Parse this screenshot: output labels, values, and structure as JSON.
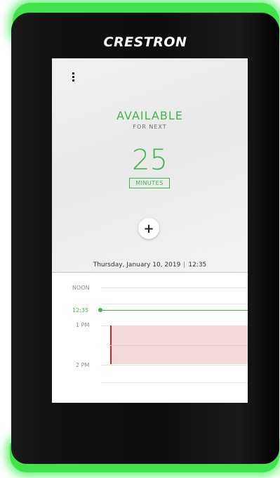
{
  "device": {
    "brand": "CRESTRON"
  },
  "room": {
    "status": "AVAILABLE",
    "status_sub": "FOR NEXT",
    "minutes": "25",
    "minutes_label": "MINUTES",
    "add_button": "+",
    "date": "Thursday, January 10, 2019",
    "time": "12:35"
  },
  "timeline": {
    "labels": [
      "NOON",
      "12:35",
      "1 PM",
      "2 PM"
    ]
  },
  "colors": {
    "accent": "#45b552",
    "glow": "#3ee44a",
    "meeting_fill": "#f3d9d9",
    "meeting_bar": "#d42525"
  },
  "icons": {
    "menu": "kebab-icon",
    "add": "plus-icon"
  }
}
